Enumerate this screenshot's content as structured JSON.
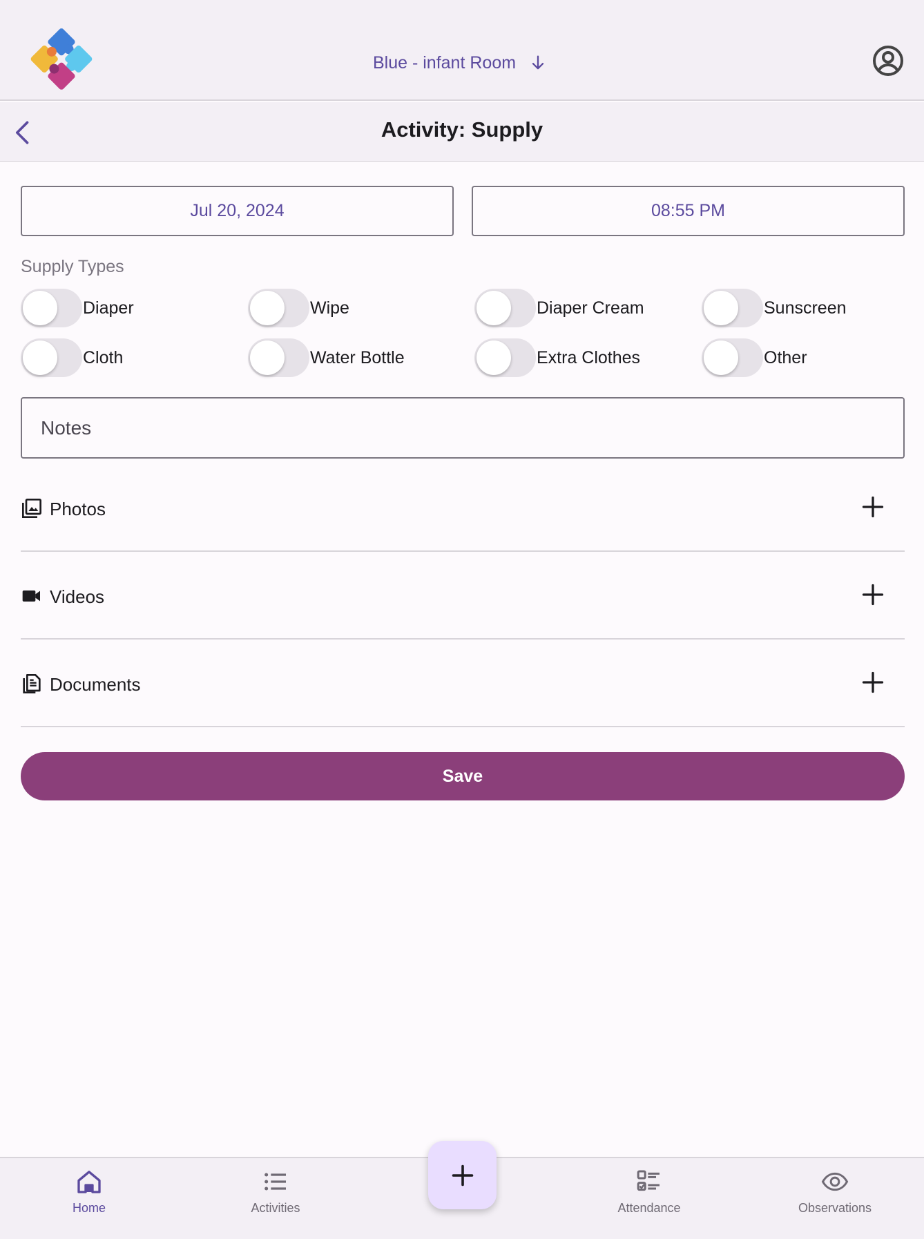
{
  "header": {
    "room_name": "Blue - infant Room"
  },
  "subheader": {
    "title": "Activity: Supply"
  },
  "form": {
    "date": "Jul 20, 2024",
    "time": "08:55 PM",
    "supply_types_label": "Supply Types",
    "supply_types": [
      {
        "label": "Diaper",
        "checked": false
      },
      {
        "label": "Wipe",
        "checked": false
      },
      {
        "label": "Diaper Cream",
        "checked": false
      },
      {
        "label": "Sunscreen",
        "checked": false
      },
      {
        "label": "Cloth",
        "checked": false
      },
      {
        "label": "Water Bottle",
        "checked": false
      },
      {
        "label": "Extra Clothes",
        "checked": false
      },
      {
        "label": "Other",
        "checked": false
      }
    ],
    "notes_placeholder": "Notes",
    "notes_value": ""
  },
  "attachments": {
    "photos_label": "Photos",
    "videos_label": "Videos",
    "documents_label": "Documents"
  },
  "actions": {
    "save_label": "Save"
  },
  "bottom_nav": {
    "home_label": "Home",
    "activities_label": "Activities",
    "attendance_label": "Attendance",
    "observations_label": "Observations",
    "active": "Home"
  },
  "colors": {
    "accent": "#5b4a9e",
    "save_button": "#8b3f7a",
    "fab": "#e9ddff",
    "bar_background": "#f3eff5"
  },
  "icons": {
    "logo": "puzzle-logo",
    "room_dropdown": "arrow-down-icon",
    "account": "account-circle-icon",
    "back": "chevron-left-icon",
    "photos": "photo-library-icon",
    "videos": "videocam-icon",
    "documents": "document-icon",
    "add": "plus-icon",
    "home": "home-icon",
    "activities": "list-icon",
    "attendance": "checklist-icon",
    "observations": "eye-icon"
  }
}
